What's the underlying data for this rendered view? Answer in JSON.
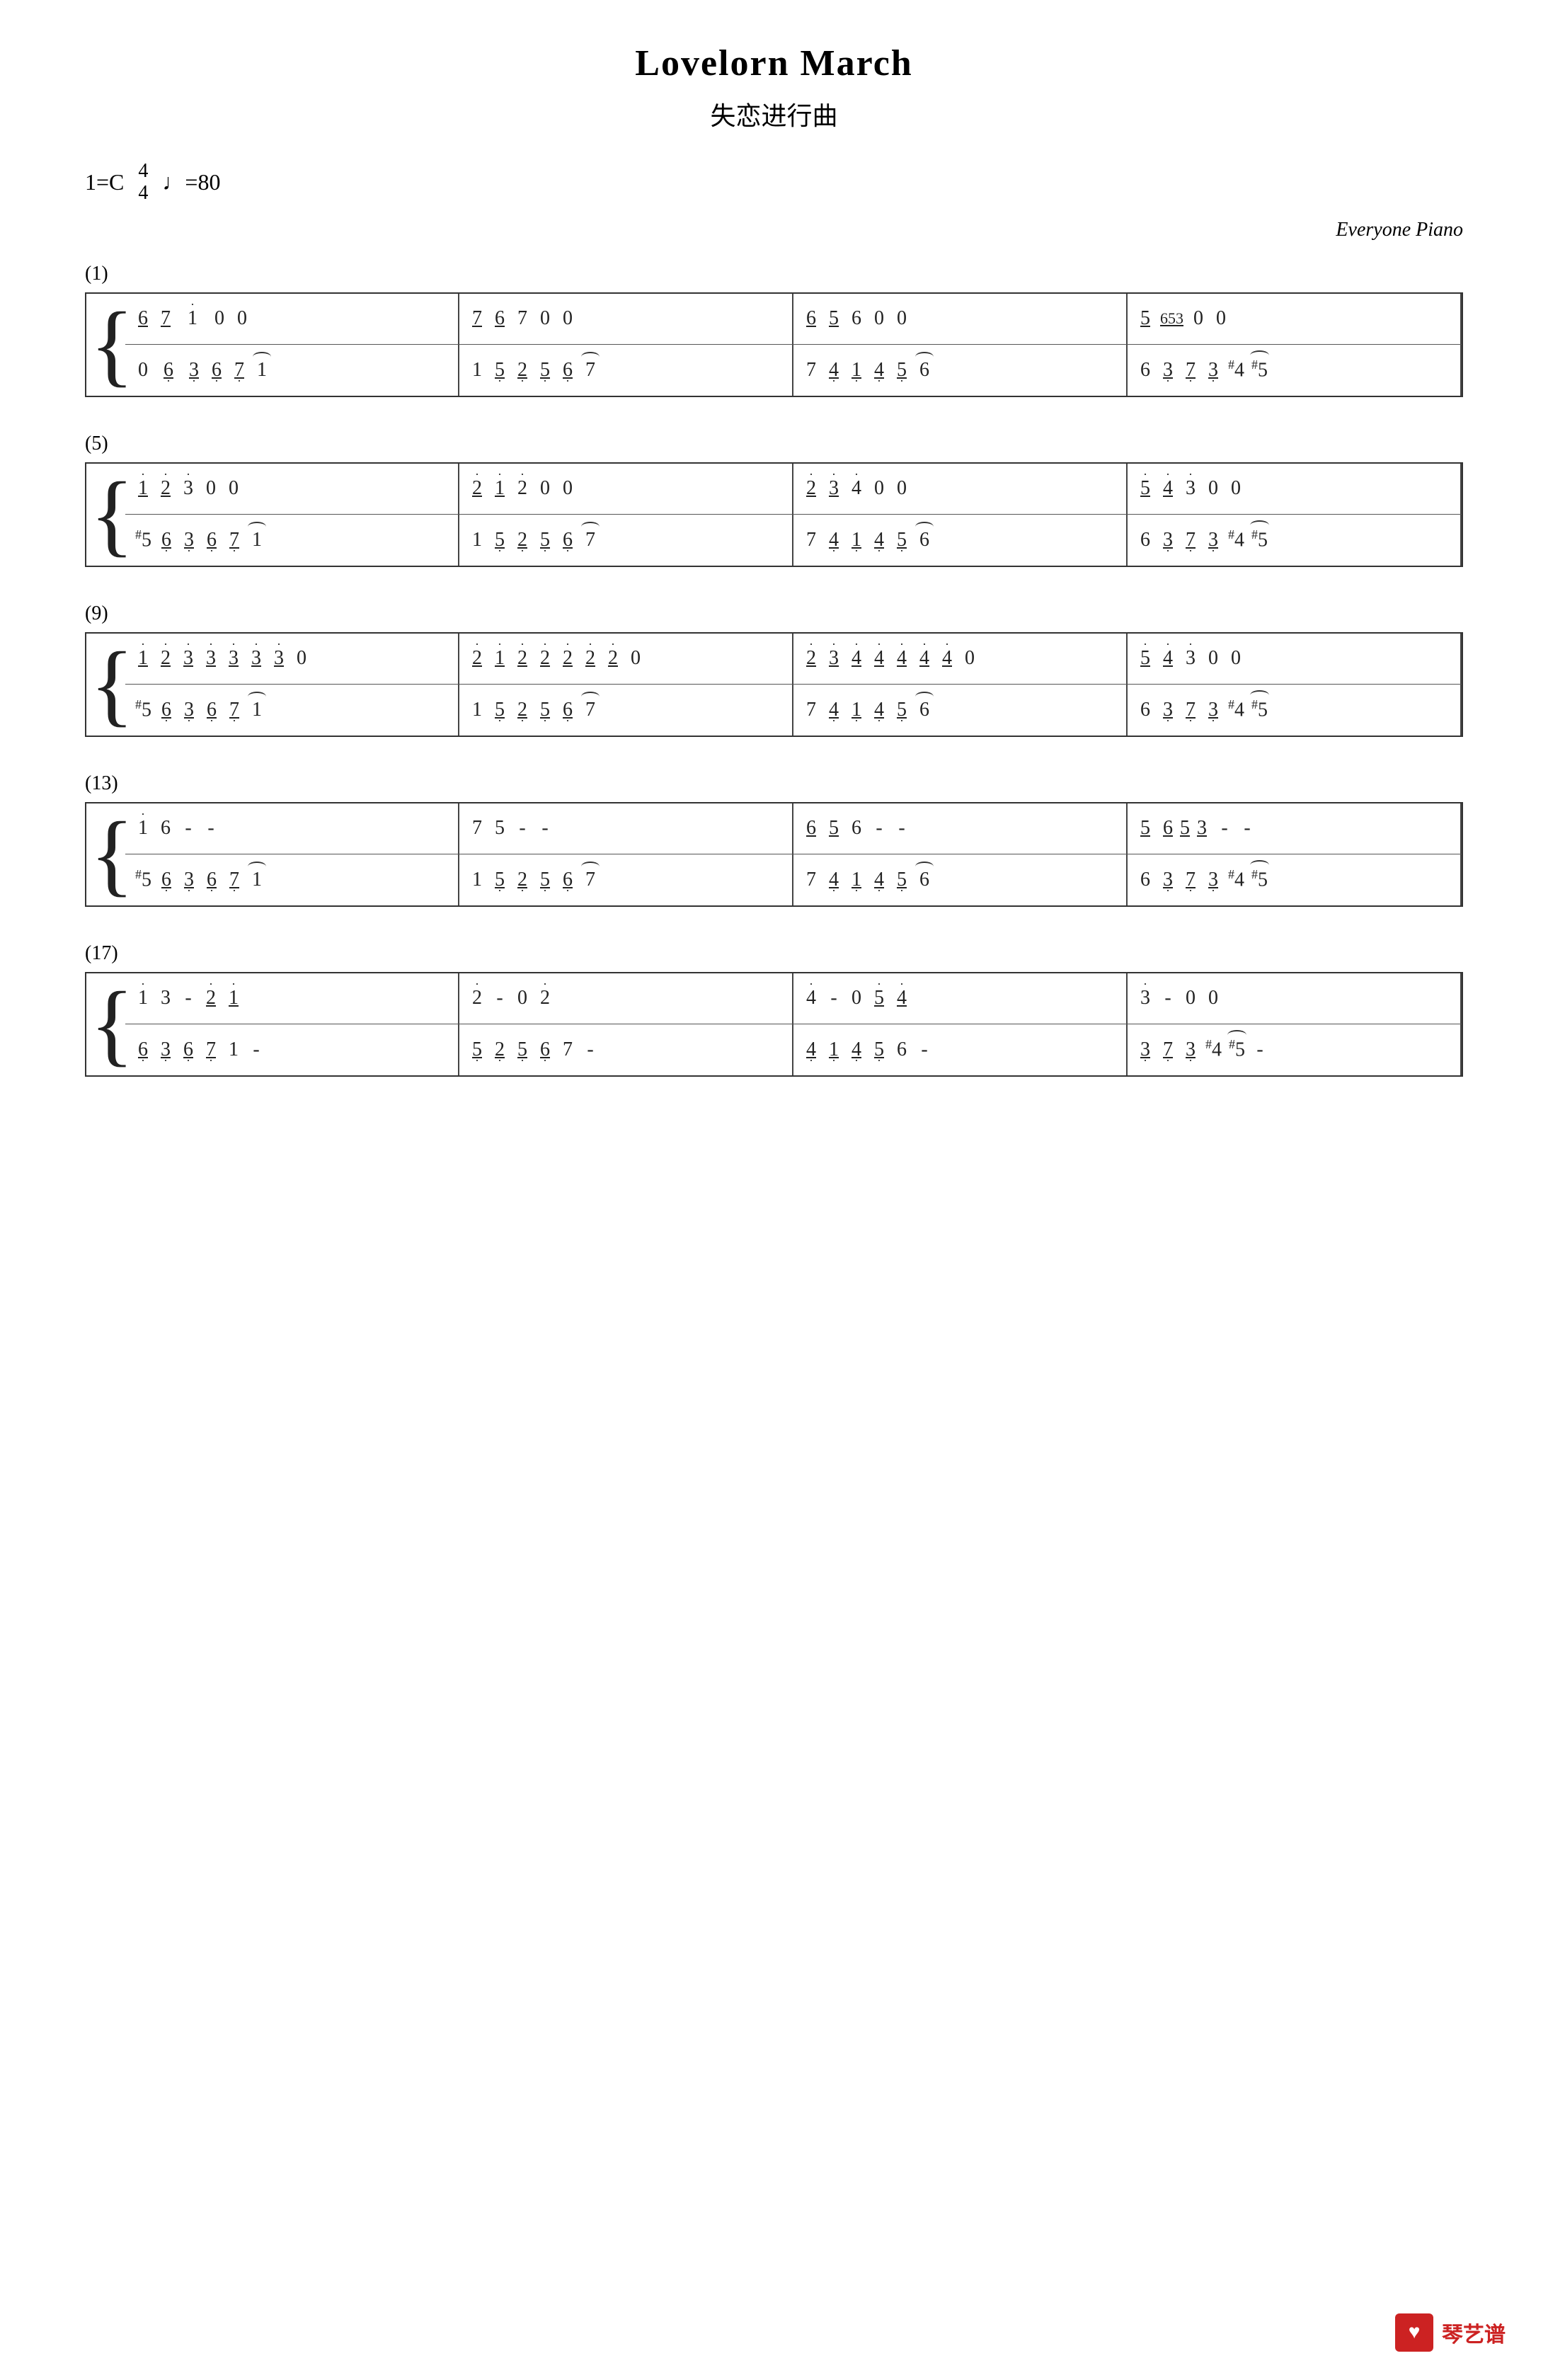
{
  "title": "Lovelorn March",
  "subtitle": "失恋进行曲",
  "key": "1=C",
  "time_sig": {
    "top": "4",
    "bottom": "4"
  },
  "tempo": "♩=80",
  "attribution": "Everyone Piano",
  "sections": [
    {
      "label": "(1)"
    },
    {
      "label": "(5)"
    },
    {
      "label": "(9)"
    },
    {
      "label": "(13)"
    },
    {
      "label": "(17)"
    }
  ],
  "logo": "琴艺谱"
}
